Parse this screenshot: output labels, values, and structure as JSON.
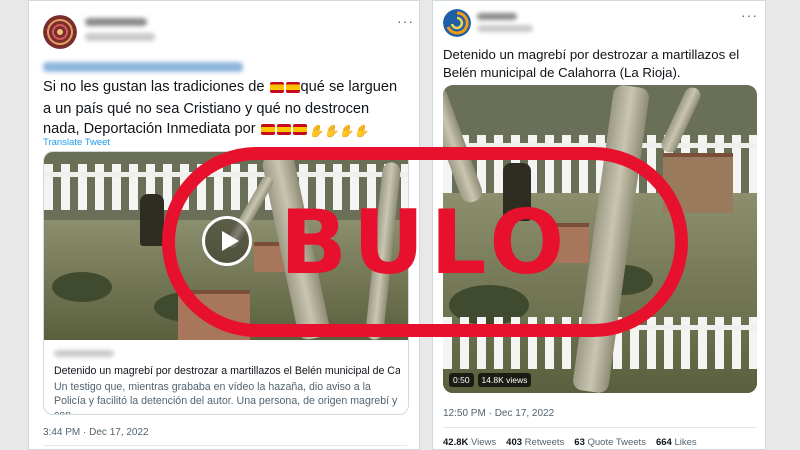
{
  "tweet_left": {
    "text_line1": "Si no les gustan las tradiciones de",
    "text_line1_after": "qué se larguen",
    "text_line2": "a un país qué no sea Cristiano y qué no destrocen",
    "text_line3": "nada, Deportación Inmediata por",
    "translate_label": "Translate Tweet",
    "card_title": "Detenido un magrebí por destrozar a martillazos el Belén municipal de Calahorr…",
    "card_description": "Un testigo que, mientras grababa en vídeo la hazaña, dio aviso a la Policía y facilitó la detención del autor. Una persona, de origen magrebí y con …",
    "timestamp": "3:44 PM · Dec 17, 2022",
    "more_icon": "more-dots-icon",
    "play_icon": "play-icon",
    "flag_icon": "spain-flag-emoji",
    "pray_icon": "folded-hands-emoji"
  },
  "tweet_right": {
    "text": "Detenido un magrebí por destrozar a martillazos el Belén municipal de Calahorra (La Rioja).",
    "video_time": "0:50",
    "video_views": "14.8K views",
    "timestamp": "12:50 PM · Dec 17, 2022",
    "stats": [
      {
        "count": "42.8K",
        "label": "Views"
      },
      {
        "count": "403",
        "label": "Retweets"
      },
      {
        "count": "63",
        "label": "Quote Tweets"
      },
      {
        "count": "664",
        "label": "Likes"
      }
    ],
    "more_icon": "more-dots-icon"
  },
  "stamp": {
    "text": "BULO",
    "color": "#e8112d"
  },
  "colors": {
    "link": "#1d9bf0",
    "text": "#0f1419",
    "muted": "#536471"
  }
}
